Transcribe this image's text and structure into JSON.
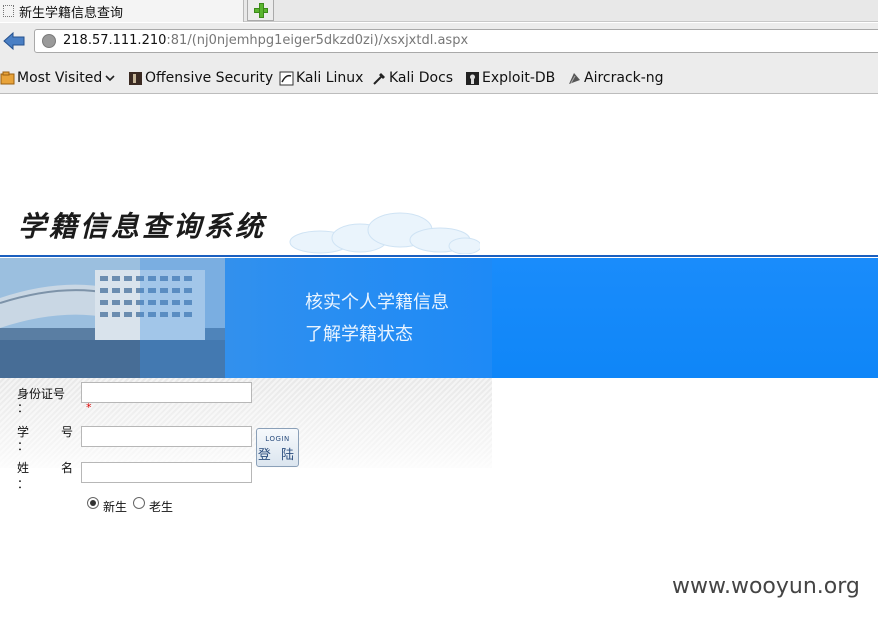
{
  "browser": {
    "tab_title": "新生学籍信息查询",
    "url_host": "218.57.111.210",
    "url_rest": ":81/(nj0njemhpg1eiger5dkzd0zi)/xsxjxtdl.aspx",
    "bookmarks": [
      {
        "label": "Most Visited",
        "icon": "most-visited-icon"
      },
      {
        "label": "Offensive Security",
        "icon": "offsec-icon"
      },
      {
        "label": "Kali Linux",
        "icon": "kali-icon"
      },
      {
        "label": "Kali Docs",
        "icon": "kali-docs-icon"
      },
      {
        "label": "Exploit-DB",
        "icon": "exploit-db-icon"
      },
      {
        "label": "Aircrack-ng",
        "icon": "aircrack-icon"
      }
    ]
  },
  "page": {
    "logo_text": "学籍信息查询系统",
    "slogan_line1": "核实个人学籍信息",
    "slogan_line2": "了解学籍状态",
    "form": {
      "id_label": "身份证号",
      "student_no_label_1": "学",
      "student_no_label_2": "号",
      "name_label_1": "姓",
      "name_label_2": "名",
      "colon": "：",
      "required_mark": "*",
      "id_value": "",
      "student_no_value": "",
      "name_value": "",
      "login_en": "LOGIN",
      "login_zh": "登 陆",
      "radio_new": "新生",
      "radio_old": "老生",
      "selected": "新生"
    },
    "watermark": "www.wooyun.org"
  },
  "colors": {
    "banner_blue": "#1e8af6",
    "line_blue": "#1b5fbf",
    "required_red": "#dd0000"
  }
}
